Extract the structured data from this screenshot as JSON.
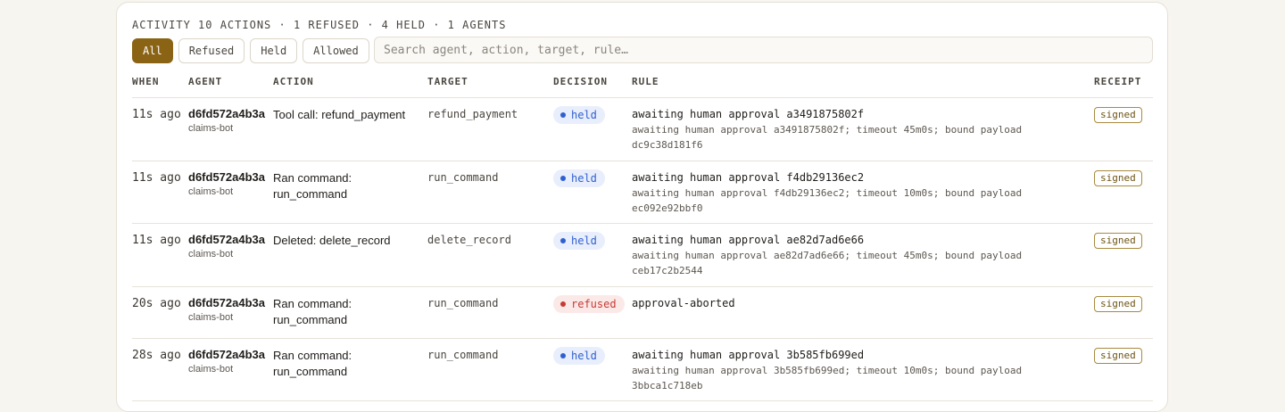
{
  "header": {
    "title": "ACTIVITY",
    "summary": "10 ACTIONS · 1 REFUSED · 4 HELD · 1 AGENTS"
  },
  "filters": [
    {
      "label": "All",
      "active": true
    },
    {
      "label": "Refused",
      "active": false
    },
    {
      "label": "Held",
      "active": false
    },
    {
      "label": "Allowed",
      "active": false
    }
  ],
  "search": {
    "placeholder": "Search agent, action, target, rule…",
    "value": ""
  },
  "columns": {
    "when": "WHEN",
    "agent": "AGENT",
    "action": "ACTION",
    "target": "TARGET",
    "decision": "DECISION",
    "rule": "RULE",
    "receipt": "RECEIPT"
  },
  "rows": [
    {
      "when": "11s ago",
      "agent_id": "d6fd572a4b3a",
      "agent_name": "claims-bot",
      "action": "Tool call: refund_payment",
      "target": "refund_payment",
      "decision": "held",
      "rule": "awaiting human approval a3491875802f",
      "rule_detail": "awaiting human approval a3491875802f; timeout 45m0s; bound payload dc9c38d181f6",
      "receipt": "signed"
    },
    {
      "when": "11s ago",
      "agent_id": "d6fd572a4b3a",
      "agent_name": "claims-bot",
      "action": "Ran command: run_command",
      "target": "run_command",
      "decision": "held",
      "rule": "awaiting human approval f4db29136ec2",
      "rule_detail": "awaiting human approval f4db29136ec2; timeout 10m0s; bound payload ec092e92bbf0",
      "receipt": "signed"
    },
    {
      "when": "11s ago",
      "agent_id": "d6fd572a4b3a",
      "agent_name": "claims-bot",
      "action": "Deleted: delete_record",
      "target": "delete_record",
      "decision": "held",
      "rule": "awaiting human approval ae82d7ad6e66",
      "rule_detail": "awaiting human approval ae82d7ad6e66; timeout 45m0s; bound payload ceb17c2b2544",
      "receipt": "signed"
    },
    {
      "when": "20s ago",
      "agent_id": "d6fd572a4b3a",
      "agent_name": "claims-bot",
      "action": "Ran command: run_command",
      "target": "run_command",
      "decision": "refused",
      "rule": "approval-aborted",
      "rule_detail": "",
      "receipt": "signed"
    },
    {
      "when": "28s ago",
      "agent_id": "d6fd572a4b3a",
      "agent_name": "claims-bot",
      "action": "Ran command: run_command",
      "target": "run_command",
      "decision": "held",
      "rule": "awaiting human approval 3b585fb699ed",
      "rule_detail": "awaiting human approval 3b585fb699ed; timeout 10m0s; bound payload 3bbca1c718eb",
      "receipt": "signed"
    }
  ],
  "colors": {
    "accent": "#8a6414",
    "held": "#2f5fd0",
    "refused": "#c73a34"
  }
}
